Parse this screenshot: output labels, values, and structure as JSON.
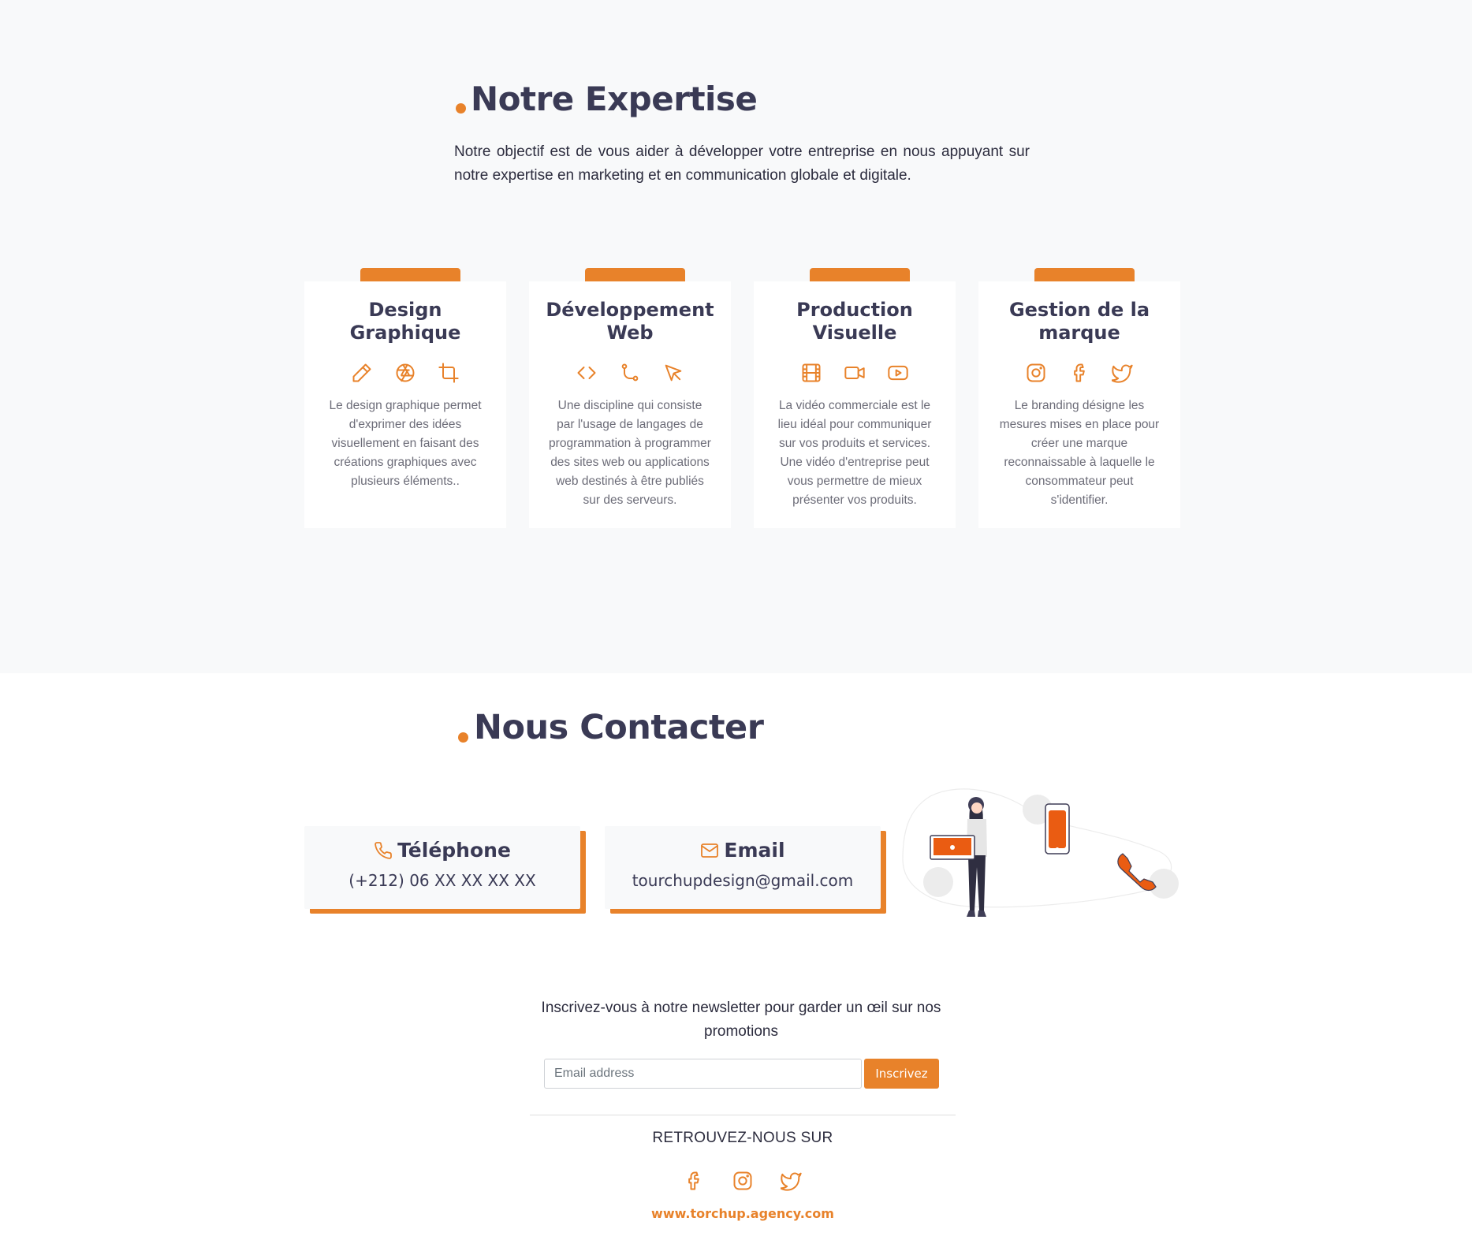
{
  "expertise": {
    "title": "Notre Expertise",
    "intro": "Notre objectif est de vous aider à développer votre entreprise en nous appuyant sur notre expertise en marketing et en communication globale et digitale.",
    "cards": [
      {
        "title": "Design Graphique",
        "icons": [
          "pen-icon",
          "aperture-icon",
          "crop-icon"
        ],
        "text": "Le design graphique permet d'exprimer des idées visuellement en faisant des créations graphiques avec plusieurs éléments.."
      },
      {
        "title": "Développement Web",
        "icons": [
          "code-icon",
          "git-branch-icon",
          "cursor-icon"
        ],
        "text": "Une discipline qui consiste par l'usage de langages de programmation à programmer des sites web ou applications web destinés à être publiés sur des serveurs."
      },
      {
        "title": "Production Visuelle",
        "icons": [
          "film-icon",
          "video-camera-icon",
          "youtube-icon"
        ],
        "text": "La vidéo commerciale est le lieu idéal pour communiquer sur vos produits et services. Une vidéo d'entreprise peut vous permettre de mieux présenter vos produits."
      },
      {
        "title": "Gestion de la marque",
        "icons": [
          "instagram-icon",
          "facebook-icon",
          "twitter-icon"
        ],
        "text": "Le branding désigne les mesures mises en place pour créer une marque reconnaissable à laquelle le consommateur peut s'identifier."
      }
    ]
  },
  "contact": {
    "title": "Nous Contacter",
    "phone": {
      "label": "Téléphone",
      "value": "(+212) 06 XX XX XX XX",
      "icon": "phone-icon"
    },
    "email": {
      "label": "Email",
      "value": "tourchupdesign@gmail.com",
      "icon": "mail-icon"
    }
  },
  "newsletter": {
    "text": "Inscrivez-vous à notre newsletter pour garder un œil sur nos promotions",
    "placeholder": "Email address",
    "button": "Inscrivez"
  },
  "footer": {
    "follow": "RETROUVEZ-NOUS SUR",
    "socials": [
      "facebook-icon",
      "instagram-icon",
      "twitter-icon"
    ],
    "website": "www.torchup.agency.com"
  },
  "colors": {
    "accent": "#e8822a",
    "heading": "#3a3a55",
    "background": "#f8f9fa"
  }
}
